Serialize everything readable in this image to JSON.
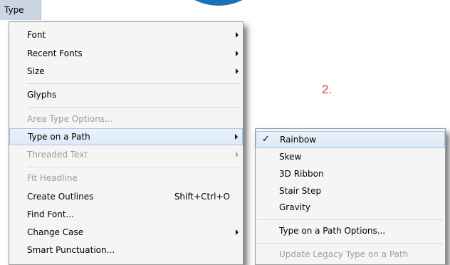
{
  "menubar": {
    "type_label": "Type"
  },
  "annotation": {
    "number": "2."
  },
  "main_menu": {
    "font": "Font",
    "recent_fonts": "Recent Fonts",
    "size": "Size",
    "glyphs": "Glyphs",
    "area_type_options": "Area Type Options...",
    "type_on_a_path": "Type on a Path",
    "threaded_text": "Threaded Text",
    "fit_headline": "Fit Headline",
    "create_outlines": "Create Outlines",
    "create_outlines_shortcut": "Shift+Ctrl+O",
    "find_font": "Find Font...",
    "change_case": "Change Case",
    "smart_punctuation": "Smart Punctuation..."
  },
  "submenu": {
    "check_mark": "✓",
    "rainbow": "Rainbow",
    "skew": "Skew",
    "ribbon_3d": "3D Ribbon",
    "stair_step": "Stair Step",
    "gravity": "Gravity",
    "options": "Type on a Path Options...",
    "update_legacy": "Update Legacy Type on a Path"
  }
}
